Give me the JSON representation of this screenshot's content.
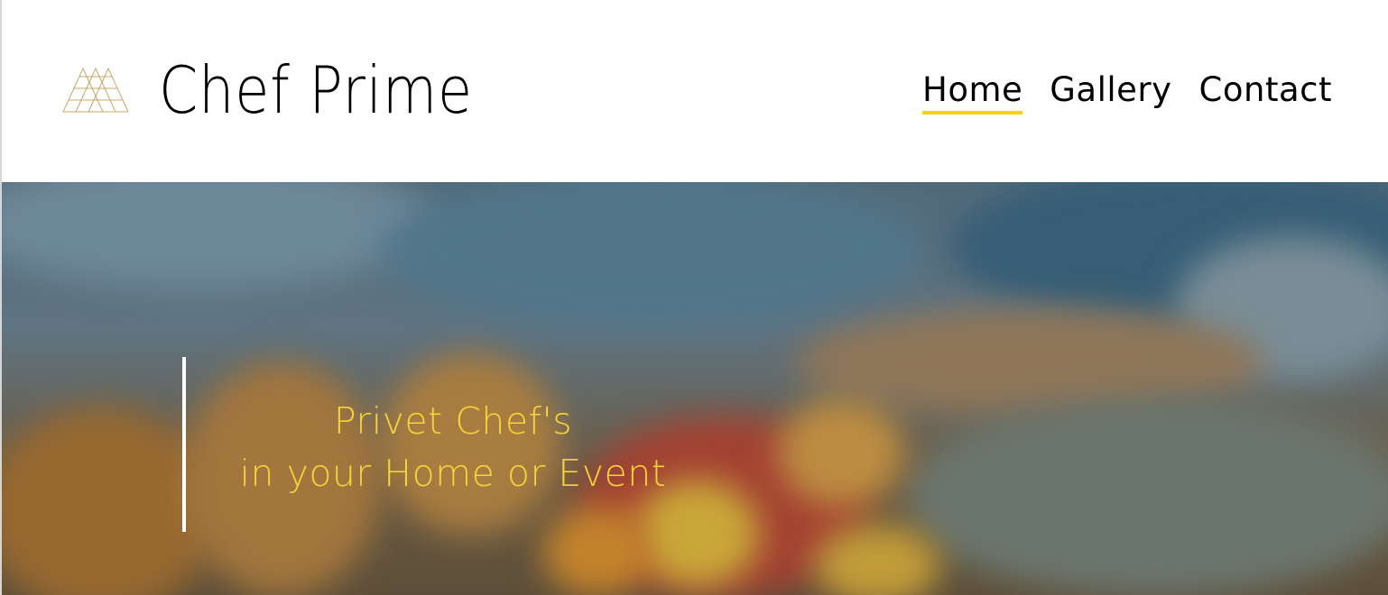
{
  "brand": {
    "name": "Chef Prime",
    "logo_icon": "triangles-logo-icon",
    "logo_color": "#c9a86a"
  },
  "nav": {
    "items": [
      {
        "label": "Home",
        "active": true
      },
      {
        "label": "Gallery",
        "active": false
      },
      {
        "label": "Contact",
        "active": false
      }
    ],
    "active_color": "#f2d31a"
  },
  "hero": {
    "line1": "Privet Chef's",
    "line2": "in your Home or Event",
    "text_color": "#f4d53a",
    "background": "blurred-banquet-table-with-flowers"
  }
}
